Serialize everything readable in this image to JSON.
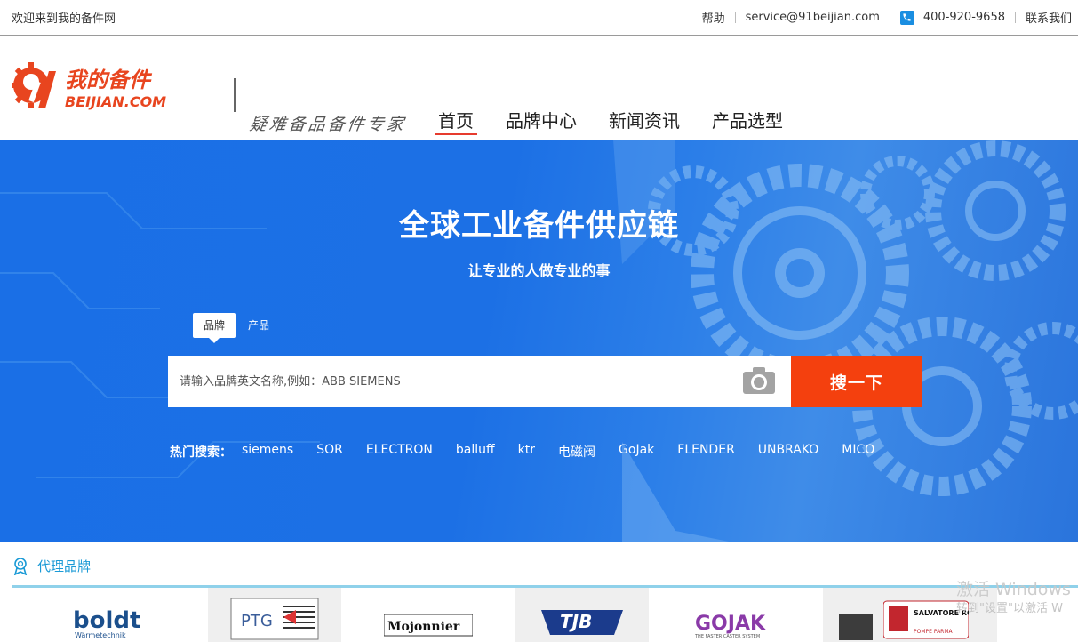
{
  "topbar": {
    "welcome": "欢迎来到我的备件网",
    "help": "帮助",
    "email": "service@91beijian.com",
    "phone": "400-920-9658",
    "contact": "联系我们"
  },
  "header": {
    "logo_cn": "我的备件",
    "logo_en": "BEIJIAN.COM",
    "slogan": "疑难备品备件专家",
    "nav": [
      "首页",
      "品牌中心",
      "新闻资讯",
      "产品选型"
    ]
  },
  "hero": {
    "title": "全球工业备件供应链",
    "subtitle": "让专业的人做专业的事",
    "tabs": [
      "品牌",
      "产品"
    ],
    "search_placeholder": "请输入品牌英文名称,例如：ABB SIEMENS",
    "search_button": "搜一下",
    "hot_label": "热门搜索：",
    "hot_items": [
      "siemens",
      "SOR",
      "ELECTRON",
      "balluff",
      "ktr",
      "电磁阀",
      "GoJak",
      "FLENDER",
      "UNBRAKO",
      "MICO"
    ]
  },
  "brands": {
    "title": "代理品牌",
    "items": [
      "boldt",
      "PTG",
      "Mojonnier",
      "TJB",
      "GOJAK",
      "",
      "SALVATORE ROBUSCHI"
    ]
  },
  "watermark": {
    "line1": "激活 Windows",
    "line2": "转到\"设置\"以激活 W"
  },
  "colors": {
    "accent": "#f4400e",
    "hero_blue": "#1a6fe6",
    "link_blue": "#1a9ad6"
  }
}
